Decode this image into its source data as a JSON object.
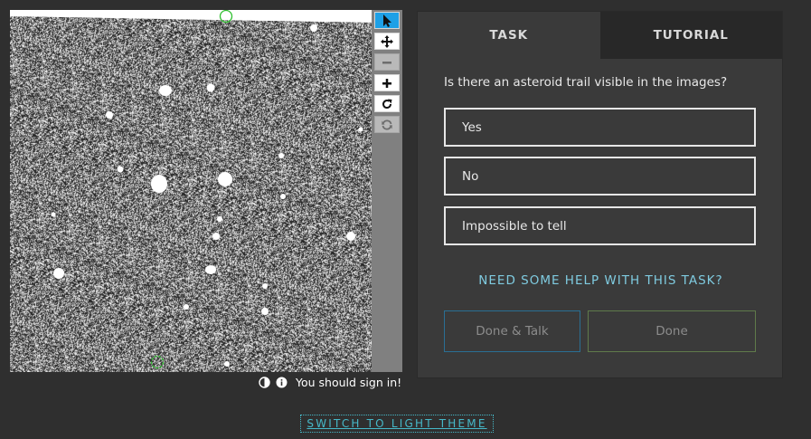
{
  "viewer": {
    "tools": [
      {
        "name": "pointer-tool",
        "icon": "cursor-arrow-icon",
        "state": "active"
      },
      {
        "name": "pan-tool",
        "icon": "move-arrows-icon",
        "state": "normal"
      },
      {
        "name": "zoom-out-tool",
        "icon": "minus-icon",
        "state": "disabled"
      },
      {
        "name": "zoom-in-tool",
        "icon": "plus-icon",
        "state": "normal"
      },
      {
        "name": "rotate-tool",
        "icon": "rotate-icon",
        "state": "normal"
      },
      {
        "name": "reset-tool",
        "icon": "refresh-icon",
        "state": "disabled"
      }
    ],
    "footer": {
      "contrast_icon": "contrast-icon",
      "info_icon": "info-icon",
      "sign_in_text": "You should sign in!"
    }
  },
  "task_panel": {
    "tabs": [
      {
        "label": "TASK",
        "active": true
      },
      {
        "label": "TUTORIAL",
        "active": false
      }
    ],
    "question": "Is there an asteroid trail visible in the images?",
    "answers": [
      "Yes",
      "No",
      "Impossible to tell"
    ],
    "help_link": "NEED SOME HELP WITH THIS TASK?",
    "done_talk_label": "Done & Talk",
    "done_label": "Done"
  },
  "theme_switch_label": "SWITCH TO LIGHT THEME",
  "colors": {
    "background": "#2f2f2f",
    "panel": "#3a3a3a",
    "active_tool": "#1ea0e6",
    "link": "#7fcbe0",
    "marker": "#2fbf2f"
  }
}
